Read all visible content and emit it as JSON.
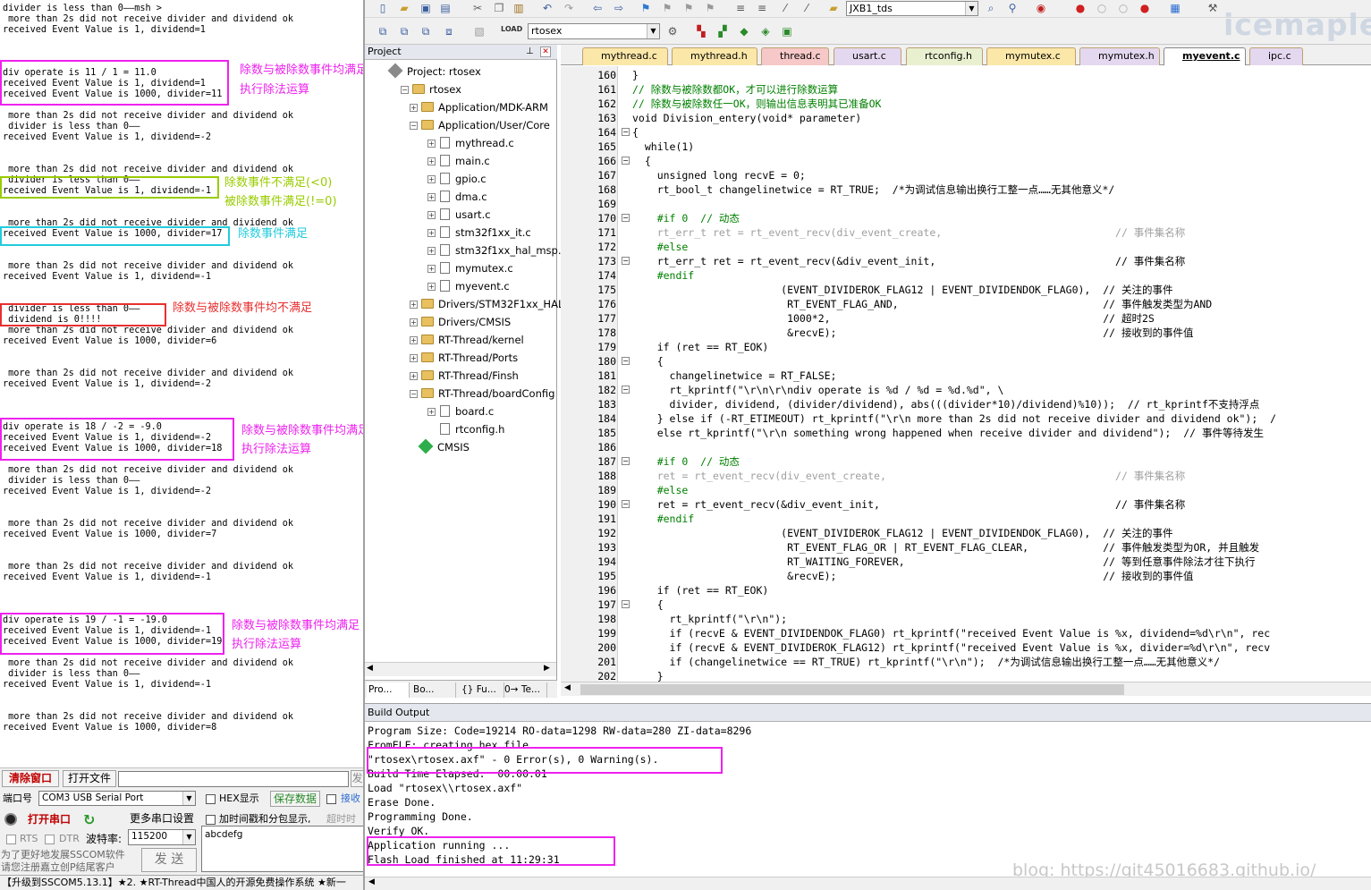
{
  "serial": {
    "lines": [
      "divider is less than 0——msh >",
      " more than 2s did not receive divider and dividend ok",
      "received Event Value is 1, dividend=1",
      "div operate is 11 / 1 = 11.0",
      "received Event Value is 1, dividend=1",
      "received Event Value is 1000, divider=11",
      " more than 2s did not receive divider and dividend ok",
      " divider is less than 0——",
      "received Event Value is 1, dividend=-2",
      " more than 2s did not receive divider and dividend ok",
      " divider is less than 0——",
      "received Event Value is 1, dividend=-1",
      " more than 2s did not receive divider and dividend ok",
      "received Event Value is 1000, divider=17",
      " more than 2s did not receive divider and dividend ok",
      "received Event Value is 1, dividend=-1",
      " divider is less than 0——",
      " dividend is 0!!!!",
      " more than 2s did not receive divider and dividend ok",
      "received Event Value is 1000, divider=6",
      " more than 2s did not receive divider and dividend ok",
      "received Event Value is 1, dividend=-2",
      "div operate is 18 / -2 = -9.0",
      "received Event Value is 1, dividend=-2",
      "received Event Value is 1000, divider=18",
      " more than 2s did not receive divider and dividend ok",
      " divider is less than 0——",
      "received Event Value is 1, dividend=-2",
      " more than 2s did not receive divider and dividend ok",
      "received Event Value is 1000, divider=7",
      " more than 2s did not receive divider and dividend ok",
      "received Event Value is 1, dividend=-1",
      "div operate is 19 / -1 = -19.0",
      "received Event Value is 1, dividend=-1",
      "received Event Value is 1000, divider=19",
      " more than 2s did not receive divider and dividend ok",
      " divider is less than 0——",
      "received Event Value is 1, dividend=-1",
      " more than 2s did not receive divider and dividend ok",
      "received Event Value is 1000, divider=8"
    ],
    "notes": {
      "both_ok_a": "除数与被除数事件均满足",
      "do_div_a": "执行除法运算",
      "not_lt0": "除数事件不满足(<0)",
      "ok_ne0": "被除数事件满足(!=0)",
      "divider_ok": "除数事件满足",
      "both_fail": "除数与被除数事件均不满足",
      "both_ok_b": "除数与被除数事件均满足",
      "do_div_b": "执行除法运算",
      "both_ok_c": "除数与被除数事件均满足",
      "do_div_c": "执行除法运算"
    },
    "controls": {
      "clear_window": "清除窗口",
      "open_file": "打开文件",
      "send_short": "发",
      "port_label": "端口号",
      "port_value": "COM3 USB Serial Port",
      "hex_display": "HEX显示",
      "save_data": "保存数据",
      "receive": "接收",
      "open_port": "打开串口",
      "more_settings": "更多串口设置",
      "timestamp": "加时间戳和分包显示,",
      "timeout": "超时时",
      "rts": "RTS",
      "dtr": "DTR",
      "baud_label": "波特率:",
      "baud_value": "115200",
      "input_text": "abcdefg",
      "promo1": "为了更好地发展SSCOM软件",
      "promo2": "请您注册嘉立创P结尾客户",
      "send": "发 送"
    },
    "status": "【升级到SSCOM5.13.1】★2. ★RT-Thread中国人的开源免费操作系统 ★新一"
  },
  "toolbar": {
    "target_combo": "JXB1_tds",
    "project_combo": "rtosex"
  },
  "watermark": "icemaple",
  "project": {
    "title": "Project",
    "root": "Project: rtosex",
    "target": "rtosex",
    "items": [
      {
        "label": "Application/MDK-ARM",
        "kind": "folder"
      },
      {
        "label": "Application/User/Core",
        "kind": "folder"
      },
      {
        "label": "mythread.c",
        "kind": "file"
      },
      {
        "label": "main.c",
        "kind": "file"
      },
      {
        "label": "gpio.c",
        "kind": "file"
      },
      {
        "label": "dma.c",
        "kind": "file"
      },
      {
        "label": "usart.c",
        "kind": "file"
      },
      {
        "label": "stm32f1xx_it.c",
        "kind": "file"
      },
      {
        "label": "stm32f1xx_hal_msp.",
        "kind": "file"
      },
      {
        "label": "mymutex.c",
        "kind": "file"
      },
      {
        "label": "myevent.c",
        "kind": "file"
      },
      {
        "label": "Drivers/STM32F1xx_HAL",
        "kind": "folder"
      },
      {
        "label": "Drivers/CMSIS",
        "kind": "folder"
      },
      {
        "label": "RT-Thread/kernel",
        "kind": "folder"
      },
      {
        "label": "RT-Thread/Ports",
        "kind": "folder"
      },
      {
        "label": "RT-Thread/Finsh",
        "kind": "folder"
      },
      {
        "label": "RT-Thread/boardConfig",
        "kind": "folder"
      },
      {
        "label": "board.c",
        "kind": "file"
      },
      {
        "label": "rtconfig.h",
        "kind": "file"
      },
      {
        "label": "CMSIS",
        "kind": "gem"
      }
    ],
    "tabs": [
      "Pro...",
      "Bo...",
      "{} Fu...",
      "0→ Te..."
    ]
  },
  "editor": {
    "tabs": [
      "mythread.c",
      "mythread.h",
      "thread.c",
      "usart.c",
      "rtconfig.h",
      "mymutex.c",
      "mymutex.h",
      "myevent.c",
      "ipc.c"
    ],
    "active_tab": "myevent.c",
    "line_numbers": [
      "160",
      "161",
      "162",
      "163",
      "164",
      "165",
      "166",
      "167",
      "168",
      "169",
      "170",
      "171",
      "172",
      "173",
      "174",
      "175",
      "176",
      "177",
      "178",
      "179",
      "180",
      "181",
      "182",
      "183",
      "184",
      "185",
      "186",
      "187",
      "188",
      "189",
      "190",
      "191",
      "192",
      "193",
      "194",
      "195",
      "196",
      "197",
      "198",
      "199",
      "200",
      "201",
      "202"
    ],
    "code": [
      "}",
      "// 除数与被除数都OK，才可以进行除数运算",
      "// 除数与被除数任一OK，则输出信息表明其已准备OK",
      "void Division_entery(void* parameter)",
      "{",
      "  while(1)",
      "  {",
      "    unsigned long recvE = 0;",
      "    rt_bool_t changelinetwice = RT_TRUE;  /*为调试信息输出换行工整一点……无其他意义*/",
      "",
      "    #if 0  // 动态",
      "    rt_err_t ret = rt_event_recv(div_event_create,                            // 事件集名称",
      "    #else",
      "    rt_err_t ret = rt_event_recv(&div_event_init,                             // 事件集名称",
      "    #endif",
      "                        (EVENT_DIVIDEROK_FLAG12 | EVENT_DIVIDENDOK_FLAG0),  // 关注的事件",
      "                         RT_EVENT_FLAG_AND,                                 // 事件触发类型为AND",
      "                         1000*2,                                            // 超时2S",
      "                         &recvE);                                           // 接收到的事件值",
      "    if (ret == RT_EOK)",
      "    {",
      "      changelinetwice = RT_FALSE;",
      "      rt_kprintf(\"\\r\\n\\r\\ndiv operate is %d / %d = %d.%d\", \\",
      "      divider, dividend, (divider/dividend), abs(((divider*10)/dividend)%10));  // rt_kprintf不支持浮点",
      "    } else if (-RT_ETIMEOUT) rt_kprintf(\"\\r\\n more than 2s did not receive divider and dividend ok\");  /",
      "    else rt_kprintf(\"\\r\\n something wrong happened when receive divider and dividend\");  // 事件等待发生",
      "",
      "    #if 0  // 动态",
      "    ret = rt_event_recv(div_event_create,                                     // 事件集名称",
      "    #else",
      "    ret = rt_event_recv(&div_event_init,                                      // 事件集名称",
      "    #endif",
      "                        (EVENT_DIVIDEROK_FLAG12 | EVENT_DIVIDENDOK_FLAG0),  // 关注的事件",
      "                         RT_EVENT_FLAG_OR | RT_EVENT_FLAG_CLEAR,            // 事件触发类型为OR, 并且触发",
      "                         RT_WAITING_FOREVER,                                // 等到任意事件除法才往下执行",
      "                         &recvE);                                           // 接收到的事件值",
      "    if (ret == RT_EOK)",
      "    {",
      "      rt_kprintf(\"\\r\\n\");",
      "      if (recvE & EVENT_DIVIDENDOK_FLAG0) rt_kprintf(\"received Event Value is %x, dividend=%d\\r\\n\", rec",
      "      if (recvE & EVENT_DIVIDEROK_FLAG12) rt_kprintf(\"received Event Value is %x, divider=%d\\r\\n\", recv",
      "      if (changelinetwice == RT_TRUE) rt_kprintf(\"\\r\\n\");  /*为调试信息输出换行工整一点……无其他意义*/",
      "    }"
    ]
  },
  "build": {
    "title": "Build Output",
    "lines": [
      "Program Size: Code=19214 RO-data=1298 RW-data=280 ZI-data=8296",
      "FromELF: creating hex file...",
      "\"rtosex\\rtosex.axf\" - 0 Error(s), 0 Warning(s).",
      "Build Time Elapsed:  00:00:01",
      "Load \"rtosex\\\\rtosex.axf\"",
      "Erase Done.",
      "Programming Done.",
      "Verify OK.",
      "Application running ...",
      "Flash Load finished at 11:29:31"
    ]
  },
  "blog": "blog: https://git45016683.github.io/",
  "colors": {
    "annot_magenta": "#ee22ee",
    "annot_lime": "#99cc00",
    "annot_cyan": "#22ccdd",
    "annot_red": "#e83030"
  }
}
